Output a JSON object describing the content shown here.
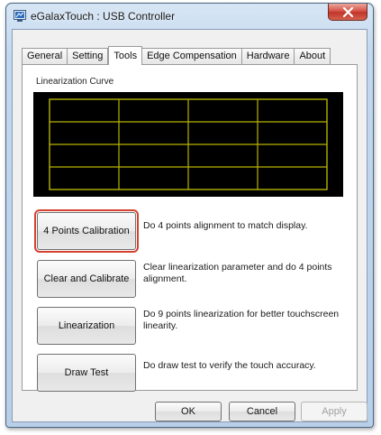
{
  "window": {
    "title": "eGalaxTouch : USB Controller"
  },
  "tabs": [
    {
      "label": "General",
      "active": false
    },
    {
      "label": "Setting",
      "active": false
    },
    {
      "label": "Tools",
      "active": true
    },
    {
      "label": "Edge Compensation",
      "active": false
    },
    {
      "label": "Hardware",
      "active": false
    },
    {
      "label": "About",
      "active": false
    }
  ],
  "tools": {
    "curve_label": "Linearization Curve",
    "grid_color": "#b7b400",
    "grid_background": "#000000",
    "actions": [
      {
        "button": "4 Points Calibration",
        "description": "Do 4 points alignment to match display.",
        "highlighted": true
      },
      {
        "button": "Clear and Calibrate",
        "description": "Clear linearization parameter and do 4 points alignment.",
        "highlighted": false
      },
      {
        "button": "Linearization",
        "description": "Do 9 points linearization for better touchscreen linearity.",
        "highlighted": false
      },
      {
        "button": "Draw Test",
        "description": "Do draw test to verify the touch accuracy.",
        "highlighted": false
      }
    ]
  },
  "footer": {
    "ok": "OK",
    "cancel": "Cancel",
    "apply": "Apply",
    "apply_enabled": false
  },
  "colors": {
    "highlight_outline": "#d5412f",
    "close_button": "#c7392e"
  }
}
